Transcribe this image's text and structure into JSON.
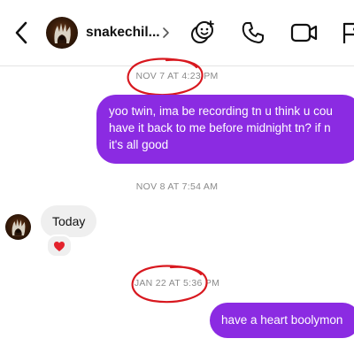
{
  "header": {
    "username": "snakechil...",
    "chevron_icon": "chevron-right-icon",
    "back_icon": "chevron-left-icon",
    "effects_icon": "effects-icon",
    "phone_icon": "phone-icon",
    "video_icon": "video-camera-icon",
    "flag_icon": "flag-icon"
  },
  "thread": {
    "timestamps": [
      "NOV 7 AT 4:23 PM",
      "NOV 8 AT 7:54 AM",
      "JAN 22 AT 5:36 PM"
    ],
    "outgoing_1": {
      "lines": [
        "yoo twin, ima be recording tn u think u cou",
        "have it back to me before midnight tn? if n",
        "it's all good"
      ]
    },
    "incoming_1": {
      "text": "Today",
      "reaction": "❤️",
      "reaction_icon": "heart-icon"
    },
    "outgoing_2": {
      "text": "have a heart boolymon"
    }
  },
  "colors": {
    "outgoing_bubble": "#8b2be2",
    "incoming_bubble": "#efefef",
    "annotation_circle": "#d8181f",
    "timestamp": "#8a8a8a"
  }
}
